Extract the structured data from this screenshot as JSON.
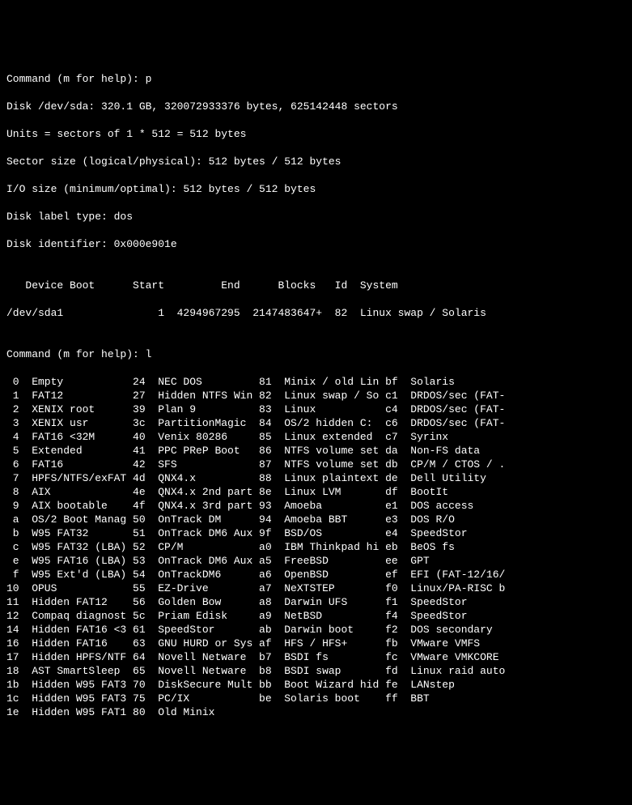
{
  "cmd1_prompt": "Command (m for help): ",
  "cmd1_input": "p",
  "blank": "",
  "disk_line": "Disk /dev/sda: 320.1 GB, 320072933376 bytes, 625142448 sectors",
  "units_line": "Units = sectors of 1 * 512 = 512 bytes",
  "sector_line": "Sector size (logical/physical): 512 bytes / 512 bytes",
  "io_line": "I/O size (minimum/optimal): 512 bytes / 512 bytes",
  "label_line": "Disk label type: dos",
  "ident_line": "Disk identifier: 0x000e901e",
  "pt_header": "   Device Boot      Start         End      Blocks   Id  System",
  "pt_row": "/dev/sda1               1  4294967295  2147483647+  82  Linux swap / Solaris",
  "cmd2_prompt": "Command (m for help): ",
  "cmd2_input": "l",
  "types": [
    {
      "a": " 0",
      "b": "Empty",
      "c": "24",
      "d": "NEC DOS",
      "e": "81",
      "f": "Minix / old Lin",
      "g": "bf",
      "h": "Solaris"
    },
    {
      "a": " 1",
      "b": "FAT12",
      "c": "27",
      "d": "Hidden NTFS Win",
      "e": "82",
      "f": "Linux swap / So",
      "g": "c1",
      "h": "DRDOS/sec (FAT-"
    },
    {
      "a": " 2",
      "b": "XENIX root",
      "c": "39",
      "d": "Plan 9",
      "e": "83",
      "f": "Linux",
      "g": "c4",
      "h": "DRDOS/sec (FAT-"
    },
    {
      "a": " 3",
      "b": "XENIX usr",
      "c": "3c",
      "d": "PartitionMagic",
      "e": "84",
      "f": "OS/2 hidden C:",
      "g": "c6",
      "h": "DRDOS/sec (FAT-"
    },
    {
      "a": " 4",
      "b": "FAT16 <32M",
      "c": "40",
      "d": "Venix 80286",
      "e": "85",
      "f": "Linux extended",
      "g": "c7",
      "h": "Syrinx"
    },
    {
      "a": " 5",
      "b": "Extended",
      "c": "41",
      "d": "PPC PReP Boot",
      "e": "86",
      "f": "NTFS volume set",
      "g": "da",
      "h": "Non-FS data"
    },
    {
      "a": " 6",
      "b": "FAT16",
      "c": "42",
      "d": "SFS",
      "e": "87",
      "f": "NTFS volume set",
      "g": "db",
      "h": "CP/M / CTOS / ."
    },
    {
      "a": " 7",
      "b": "HPFS/NTFS/exFAT",
      "c": "4d",
      "d": "QNX4.x",
      "e": "88",
      "f": "Linux plaintext",
      "g": "de",
      "h": "Dell Utility"
    },
    {
      "a": " 8",
      "b": "AIX",
      "c": "4e",
      "d": "QNX4.x 2nd part",
      "e": "8e",
      "f": "Linux LVM",
      "g": "df",
      "h": "BootIt"
    },
    {
      "a": " 9",
      "b": "AIX bootable",
      "c": "4f",
      "d": "QNX4.x 3rd part",
      "e": "93",
      "f": "Amoeba",
      "g": "e1",
      "h": "DOS access"
    },
    {
      "a": " a",
      "b": "OS/2 Boot Manag",
      "c": "50",
      "d": "OnTrack DM",
      "e": "94",
      "f": "Amoeba BBT",
      "g": "e3",
      "h": "DOS R/O"
    },
    {
      "a": " b",
      "b": "W95 FAT32",
      "c": "51",
      "d": "OnTrack DM6 Aux",
      "e": "9f",
      "f": "BSD/OS",
      "g": "e4",
      "h": "SpeedStor"
    },
    {
      "a": " c",
      "b": "W95 FAT32 (LBA)",
      "c": "52",
      "d": "CP/M",
      "e": "a0",
      "f": "IBM Thinkpad hi",
      "g": "eb",
      "h": "BeOS fs"
    },
    {
      "a": " e",
      "b": "W95 FAT16 (LBA)",
      "c": "53",
      "d": "OnTrack DM6 Aux",
      "e": "a5",
      "f": "FreeBSD",
      "g": "ee",
      "h": "GPT"
    },
    {
      "a": " f",
      "b": "W95 Ext'd (LBA)",
      "c": "54",
      "d": "OnTrackDM6",
      "e": "a6",
      "f": "OpenBSD",
      "g": "ef",
      "h": "EFI (FAT-12/16/"
    },
    {
      "a": "10",
      "b": "OPUS",
      "c": "55",
      "d": "EZ-Drive",
      "e": "a7",
      "f": "NeXTSTEP",
      "g": "f0",
      "h": "Linux/PA-RISC b"
    },
    {
      "a": "11",
      "b": "Hidden FAT12",
      "c": "56",
      "d": "Golden Bow",
      "e": "a8",
      "f": "Darwin UFS",
      "g": "f1",
      "h": "SpeedStor"
    },
    {
      "a": "12",
      "b": "Compaq diagnost",
      "c": "5c",
      "d": "Priam Edisk",
      "e": "a9",
      "f": "NetBSD",
      "g": "f4",
      "h": "SpeedStor"
    },
    {
      "a": "14",
      "b": "Hidden FAT16 <3",
      "c": "61",
      "d": "SpeedStor",
      "e": "ab",
      "f": "Darwin boot",
      "g": "f2",
      "h": "DOS secondary"
    },
    {
      "a": "16",
      "b": "Hidden FAT16",
      "c": "63",
      "d": "GNU HURD or Sys",
      "e": "af",
      "f": "HFS / HFS+",
      "g": "fb",
      "h": "VMware VMFS"
    },
    {
      "a": "17",
      "b": "Hidden HPFS/NTF",
      "c": "64",
      "d": "Novell Netware",
      "e": "b7",
      "f": "BSDI fs",
      "g": "fc",
      "h": "VMware VMKCORE"
    },
    {
      "a": "18",
      "b": "AST SmartSleep",
      "c": "65",
      "d": "Novell Netware",
      "e": "b8",
      "f": "BSDI swap",
      "g": "fd",
      "h": "Linux raid auto"
    },
    {
      "a": "1b",
      "b": "Hidden W95 FAT3",
      "c": "70",
      "d": "DiskSecure Mult",
      "e": "bb",
      "f": "Boot Wizard hid",
      "g": "fe",
      "h": "LANstep"
    },
    {
      "a": "1c",
      "b": "Hidden W95 FAT3",
      "c": "75",
      "d": "PC/IX",
      "e": "be",
      "f": "Solaris boot",
      "g": "ff",
      "h": "BBT"
    },
    {
      "a": "1e",
      "b": "Hidden W95 FAT1",
      "c": "80",
      "d": "Old Minix",
      "e": "",
      "f": "",
      "g": "",
      "h": ""
    }
  ]
}
